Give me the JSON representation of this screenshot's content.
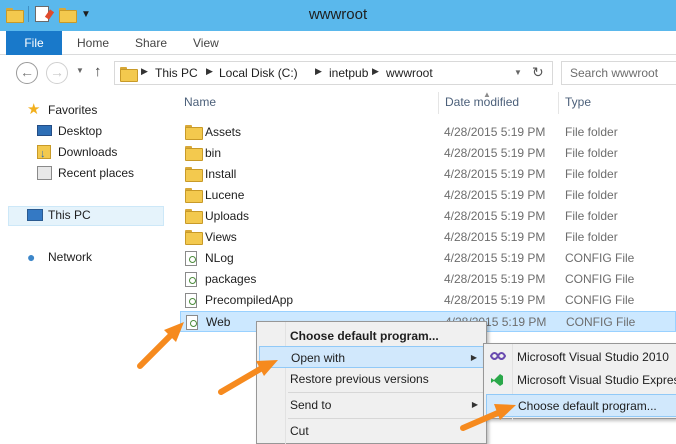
{
  "window": {
    "title": "wwwroot"
  },
  "ribbon": {
    "file": "File",
    "home": "Home",
    "share": "Share",
    "view": "View"
  },
  "address": {
    "crumbs": [
      "This PC",
      "Local Disk (C:)",
      "inetpub",
      "wwwroot"
    ],
    "search_placeholder": "Search wwwroot"
  },
  "navpane": {
    "favorites": "Favorites",
    "desktop": "Desktop",
    "downloads": "Downloads",
    "recent": "Recent places",
    "thispc": "This PC",
    "network": "Network"
  },
  "columns": {
    "name": "Name",
    "date": "Date modified",
    "type": "Type"
  },
  "files": [
    {
      "name": "Assets",
      "date": "4/28/2015 5:19 PM",
      "type": "File folder",
      "kind": "folder"
    },
    {
      "name": "bin",
      "date": "4/28/2015 5:19 PM",
      "type": "File folder",
      "kind": "folder"
    },
    {
      "name": "Install",
      "date": "4/28/2015 5:19 PM",
      "type": "File folder",
      "kind": "folder"
    },
    {
      "name": "Lucene",
      "date": "4/28/2015 5:19 PM",
      "type": "File folder",
      "kind": "folder"
    },
    {
      "name": "Uploads",
      "date": "4/28/2015 5:19 PM",
      "type": "File folder",
      "kind": "folder"
    },
    {
      "name": "Views",
      "date": "4/28/2015 5:19 PM",
      "type": "File folder",
      "kind": "folder"
    },
    {
      "name": "NLog",
      "date": "4/28/2015 5:19 PM",
      "type": "CONFIG File",
      "kind": "config"
    },
    {
      "name": "packages",
      "date": "4/28/2015 5:19 PM",
      "type": "CONFIG File",
      "kind": "config"
    },
    {
      "name": "PrecompiledApp",
      "date": "4/28/2015 5:19 PM",
      "type": "CONFIG File",
      "kind": "config"
    },
    {
      "name": "Web",
      "date": "4/28/2015 5:19 PM",
      "type": "CONFIG File",
      "kind": "config",
      "selected": true
    }
  ],
  "context_menu": {
    "choose_default": "Choose default program...",
    "open_with": "Open with",
    "restore": "Restore previous versions",
    "send_to": "Send to",
    "cut": "Cut"
  },
  "open_with_menu": {
    "vs2010": "Microsoft Visual Studio 2010",
    "vs_express": "Microsoft Visual Studio Express",
    "choose_default": "Choose default program..."
  },
  "colors": {
    "titlebar": "#5ab8ec",
    "file_tab": "#1979ca",
    "selection": "#cce8ff",
    "arrow": "#f68a1e"
  }
}
